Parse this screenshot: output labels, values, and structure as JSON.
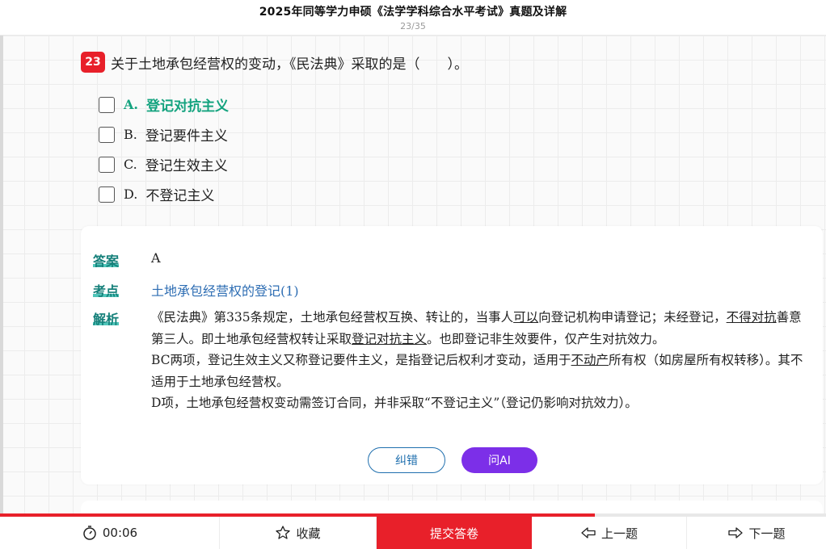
{
  "header": {
    "title": "2025年同等学力申硕《法学学科综合水平考试》真题及详解",
    "counter": "23/35"
  },
  "question": {
    "number": "23",
    "text": "关于土地承包经营权的变动，《民法典》采取的是（　　）。",
    "options": [
      {
        "letter": "A.",
        "text": "登记对抗主义",
        "correct": true
      },
      {
        "letter": "B.",
        "text": "登记要件主义",
        "correct": false
      },
      {
        "letter": "C.",
        "text": "登记生效主义",
        "correct": false
      },
      {
        "letter": "D.",
        "text": "不登记主义",
        "correct": false
      }
    ]
  },
  "answer": {
    "answer_label": "答案",
    "answer_value": "A",
    "point_label": "考点",
    "point_value": "土地承包经营权的登记(1)",
    "explain_label": "解析",
    "explain": {
      "p1_a": "《民法典》第335条规定，土地承包经营权互换、转让的，当事人",
      "p1_u1": "可以",
      "p1_b": "向登记机构申请登记；未经登记，",
      "p1_u2": "不得对抗",
      "p1_c": "善意第三人。即土地承包经营权转让采取",
      "p1_u3": "登记对抗主义",
      "p1_d": "。也即登记非生效要件，仅产生对抗效力。",
      "p2_a": "BC两项，登记生效主义又称登记要件主义，是指登记后权利才变动，适用于",
      "p2_u1": "不动产",
      "p2_b": "所有权（如房屋所有权转移）。其不适用于土地承包经营权。",
      "p3": "D项，土地承包经营权变动需签订合同，并非采取“不登记主义”（登记仍影响对抗效力）。"
    },
    "fix_button": "纠错",
    "ai_button": "问AI"
  },
  "progress": {
    "current": 23,
    "total": 35,
    "fraction": 0.72
  },
  "toolbar": {
    "timer": "00:06",
    "favorite": "收藏",
    "submit": "提交答卷",
    "prev": "上一题",
    "next": "下一题"
  },
  "colors": {
    "accent_red": "#e8202a",
    "correct_green": "#14a37f",
    "label_teal": "#15807a",
    "link_blue": "#2d6db3",
    "ai_purple": "#7c2fe8"
  },
  "icons": {
    "timer": "stopwatch-icon",
    "favorite": "star-icon",
    "prev": "arrow-left-icon",
    "next": "arrow-right-icon"
  }
}
